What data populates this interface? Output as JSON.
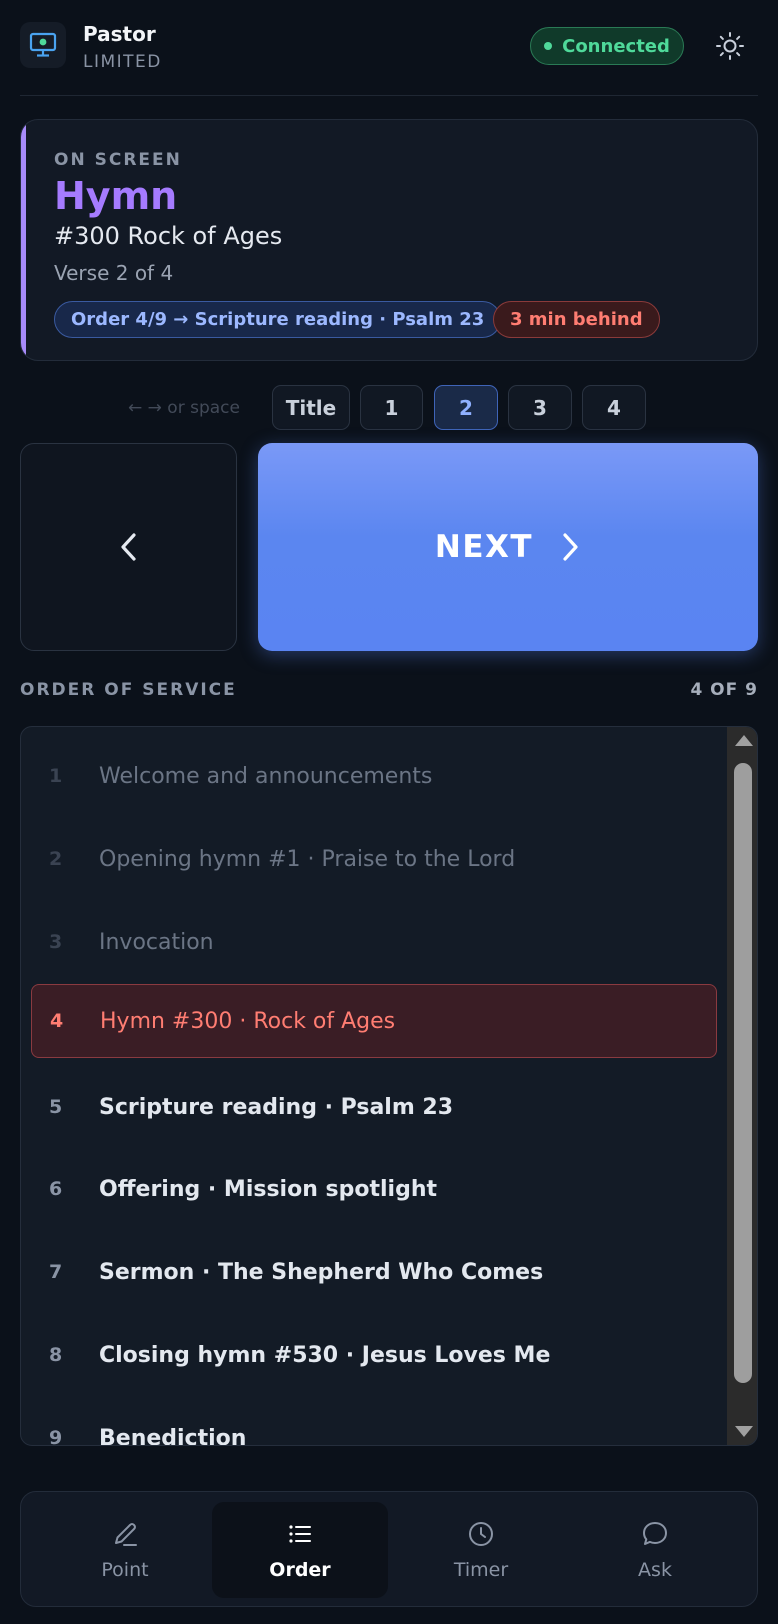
{
  "app": {
    "name": "Pastor",
    "tier": "LIMITED",
    "status": "Connected"
  },
  "on_screen": {
    "label": "ON SCREEN",
    "kind": "Hymn",
    "title": "#300 Rock of Ages",
    "verse": "Verse 2 of 4",
    "order_chip": "Order 4/9 → Scripture reading · Psalm 23",
    "behind_chip": "3 min behind"
  },
  "controls": {
    "hint": "← → or space",
    "verse_buttons": [
      "Title",
      "1",
      "2",
      "3",
      "4"
    ],
    "active_verse": "2",
    "next_label": "NEXT"
  },
  "order": {
    "heading": "ORDER OF SERVICE",
    "count": "4 OF 9",
    "current": 4,
    "items": [
      {
        "num": "1",
        "label": "Welcome and announcements"
      },
      {
        "num": "2",
        "label": "Opening hymn #1 · Praise to the Lord"
      },
      {
        "num": "3",
        "label": "Invocation"
      },
      {
        "num": "4",
        "label": "Hymn #300 · Rock of Ages"
      },
      {
        "num": "5",
        "label": "Scripture reading · Psalm 23"
      },
      {
        "num": "6",
        "label": "Offering · Mission spotlight"
      },
      {
        "num": "7",
        "label": "Sermon · The Shepherd Who Comes"
      },
      {
        "num": "8",
        "label": "Closing hymn #530 · Jesus Loves Me"
      },
      {
        "num": "9",
        "label": "Benediction"
      }
    ]
  },
  "nav": {
    "items": [
      {
        "label": "Point",
        "icon": "pencil-icon"
      },
      {
        "label": "Order",
        "icon": "list-icon"
      },
      {
        "label": "Timer",
        "icon": "clock-icon"
      },
      {
        "label": "Ask",
        "icon": "chat-bubble-icon"
      }
    ],
    "active": "Order"
  },
  "colors": {
    "background": "#0b111a",
    "accent_purple": "#a78bfa",
    "next_blue": "#5b86f0",
    "connected_green": "#4fd99a",
    "behind_red": "#ff7d72"
  }
}
